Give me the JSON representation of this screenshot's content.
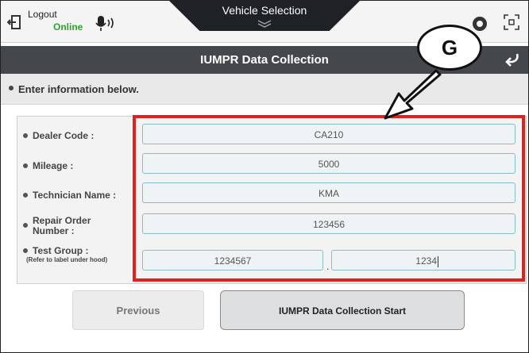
{
  "topbar": {
    "logout_label": "Logout",
    "status_label": "Online",
    "vehicle_tab_label": "Vehicle Selection"
  },
  "titlebar": {
    "title": "IUMPR Data Collection"
  },
  "instruction": {
    "text": "Enter information below."
  },
  "form": {
    "dealer_code_label": "Dealer Code :",
    "dealer_code_value": "CA210",
    "mileage_label": "Mileage :",
    "mileage_value": "5000",
    "technician_name_label": "Technician Name :",
    "technician_name_value": "KMA",
    "repair_order_label_line1": "Repair Order",
    "repair_order_label_line2": "Number :",
    "repair_order_value": "123456",
    "test_group_label": "Test Group :",
    "test_group_hint": "(Refer to label under hood)",
    "test_group_value_1": "1234567",
    "test_group_separator": ".",
    "test_group_value_2": "1234"
  },
  "buttons": {
    "previous_label": "Previous",
    "start_label": "IUMPR Data Collection Start"
  },
  "callout": {
    "letter": "G"
  },
  "colors": {
    "online": "#2fa32f",
    "highlight": "#e0221f",
    "titlebar": "#44474b",
    "field_border": "#88bcc4"
  },
  "icons": [
    "logout-icon",
    "microphone-icon",
    "chevron-down-icon",
    "settings-icon",
    "fullscreen-icon",
    "back-arrow-icon"
  ]
}
